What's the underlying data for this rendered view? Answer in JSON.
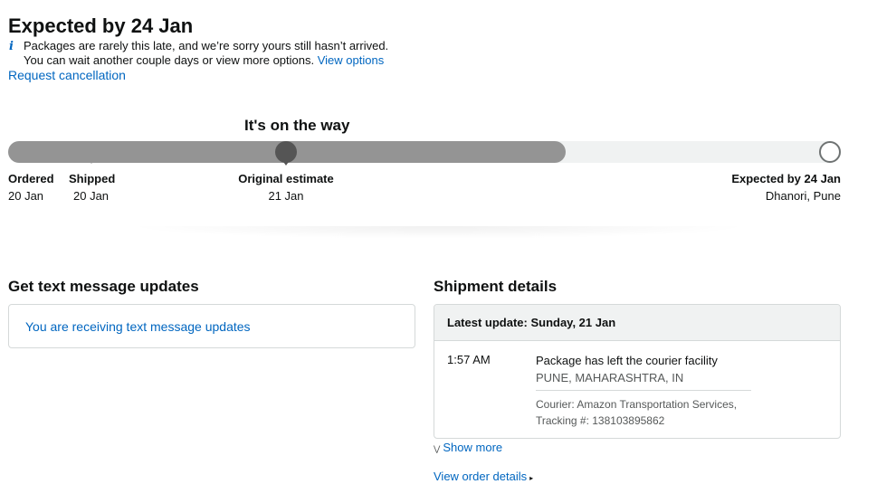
{
  "header": {
    "title": "Expected by 24 Jan",
    "notice_line1": "Packages are rarely this late, and we’re sorry yours still hasn’t arrived.",
    "notice_line2": "You can wait another couple days or view more options.",
    "view_options_link": "View options",
    "request_cancellation": "Request cancellation",
    "info_icon": "i"
  },
  "tracker": {
    "status": "It's on the way",
    "progress_fraction": 0.67,
    "milestones": [
      {
        "label": "Ordered",
        "date": "20 Jan"
      },
      {
        "label": "Shipped",
        "date": "20 Jan"
      },
      {
        "label": "Original estimate",
        "date": "21 Jan"
      },
      {
        "label": "Expected by 24 Jan",
        "date": "Dhanori, Pune"
      }
    ]
  },
  "sms": {
    "title": "Get text message updates",
    "message": "You are receiving text message updates"
  },
  "shipment": {
    "title": "Shipment details",
    "latest_update": "Latest update: Sunday, 21 Jan",
    "time": "1:57 AM",
    "event": "Package has left the courier facility",
    "location": "PUNE, MAHARASHTRA, IN",
    "courier": "Courier: Amazon Transportation Services,",
    "tracking": "Tracking #: 138103895862",
    "show_more": "Show more",
    "view_order_details": "View order details"
  },
  "colors": {
    "link": "#0066c0",
    "progress_fill": "#949494",
    "progress_track": "#f0f2f2",
    "marker": "#555555"
  }
}
